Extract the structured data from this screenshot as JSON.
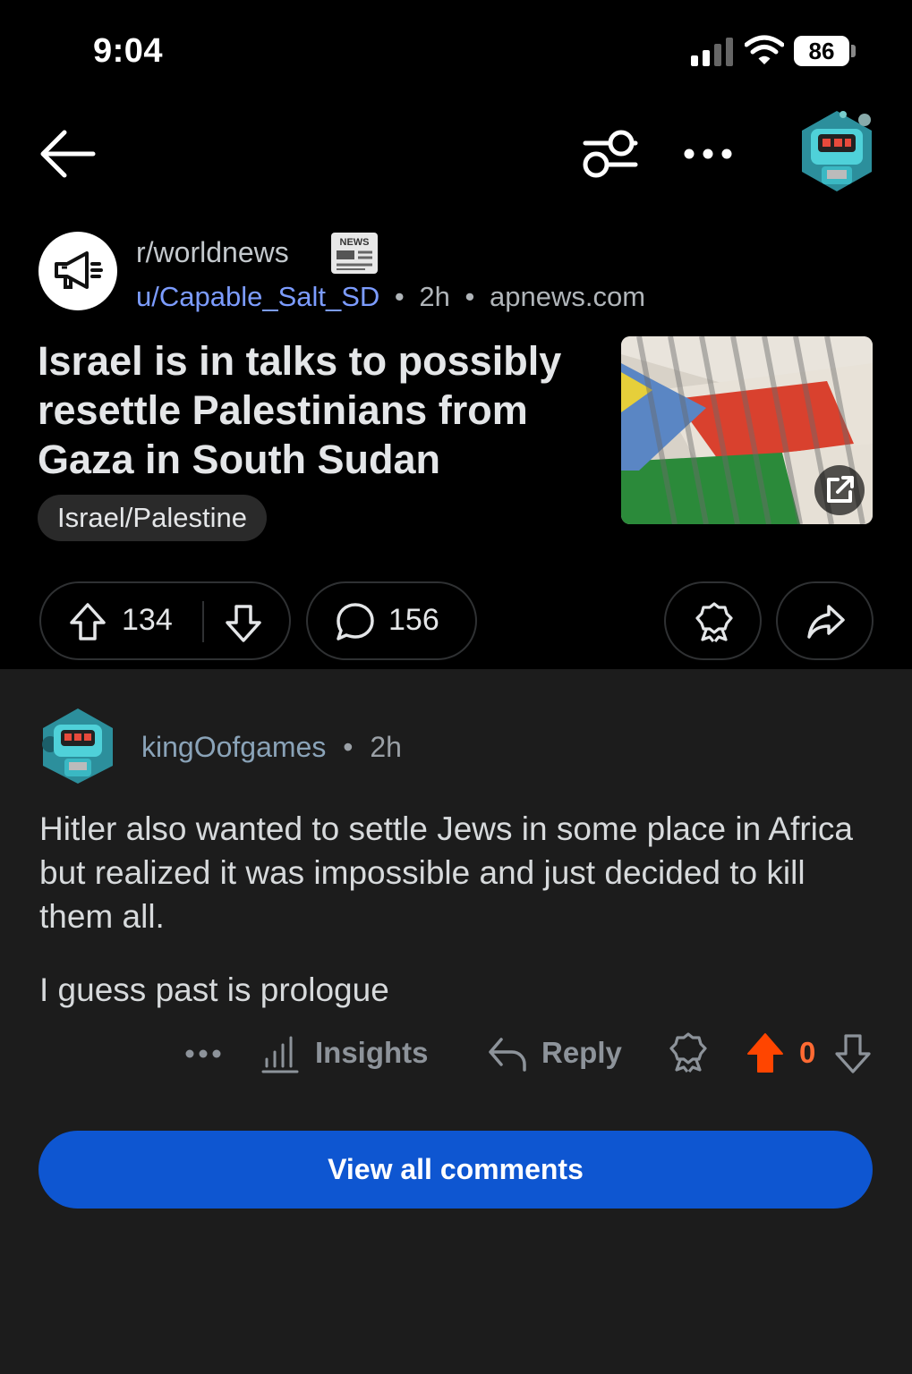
{
  "status_bar": {
    "time": "9:04",
    "battery": "86"
  },
  "post": {
    "subreddit": "r/worldnews",
    "author": "u/Capable_Salt_SD",
    "separator": "•",
    "age": "2h",
    "domain": "apnews.com",
    "news_badge": "NEWS",
    "title": "Israel is in talks to possibly resettle Palestinians from Gaza in South Sudan",
    "flair": "Israel/Palestine",
    "upvotes": "134",
    "comments": "156"
  },
  "comment": {
    "author": "kingOofgames",
    "age": "2h",
    "paragraph1": "Hitler also wanted to settle Jews in some place in Africa but realized it was impossible and just decided to kill them all.",
    "paragraph2": "I guess past is prologue",
    "insights_label": "Insights",
    "reply_label": "Reply",
    "score": "0"
  },
  "view_all_label": "View all comments",
  "colors": {
    "background_top": "#000000",
    "background_comment": "#1c1c1c",
    "accent_blue": "#0e56d1",
    "upvote_orange": "#ff4500",
    "link_blue": "#7c9cff"
  },
  "icons": [
    "back-arrow-icon",
    "filter-icon",
    "more-icon",
    "megaphone-icon",
    "external-link-icon",
    "upvote-icon",
    "downvote-icon",
    "comment-icon",
    "award-icon",
    "share-icon",
    "insights-icon",
    "reply-icon"
  ]
}
